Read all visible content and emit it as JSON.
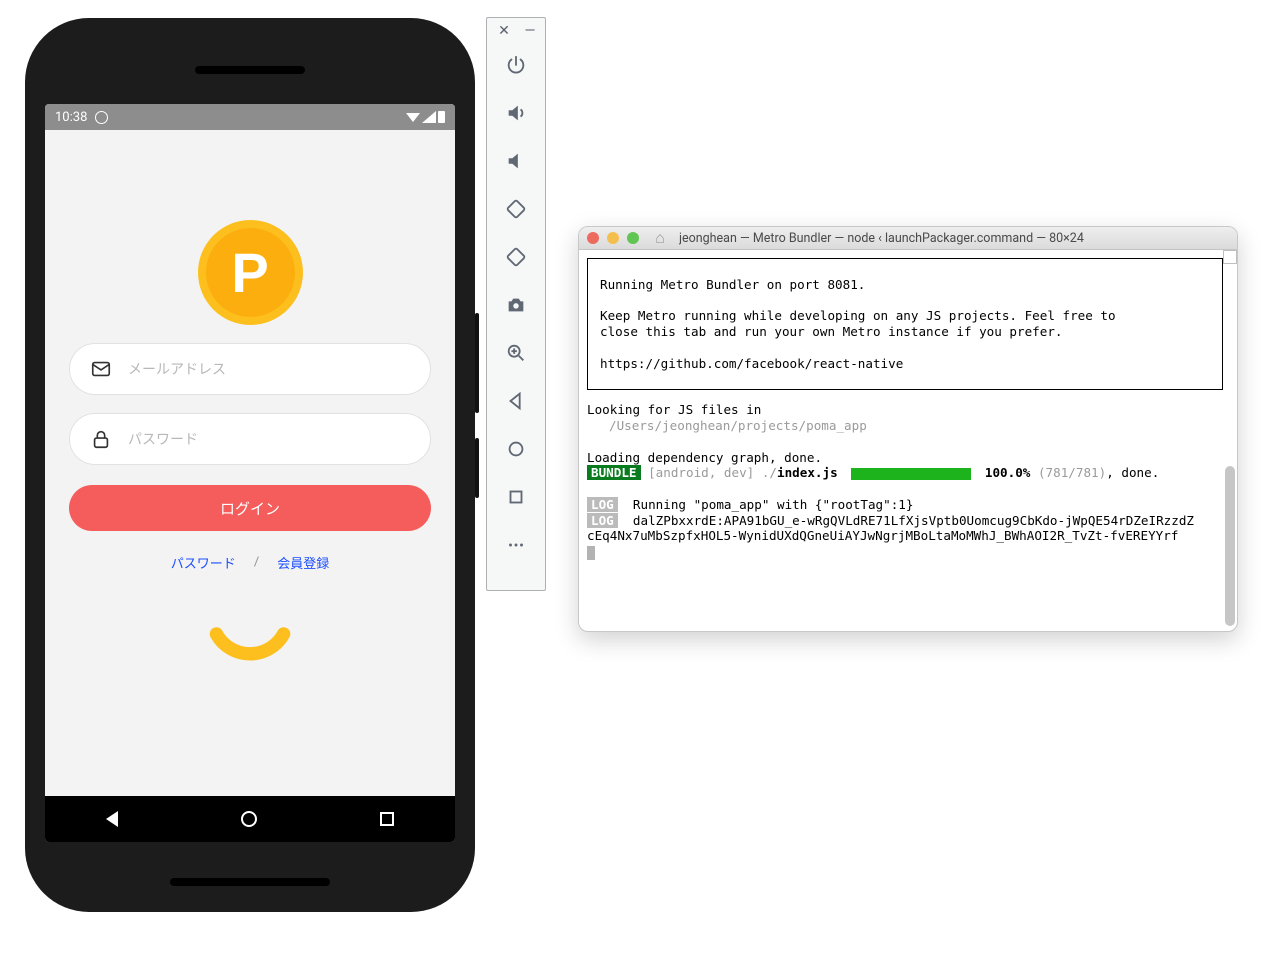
{
  "phone": {
    "status_time": "10:38",
    "coin_letter": "P",
    "email_placeholder": "メールアドレス",
    "password_placeholder": "パスワード",
    "login_label": "ログイン",
    "forgot_label": "パスワード",
    "sep": "/",
    "register_label": "会員登録"
  },
  "terminal": {
    "title": "jeonghean — Metro Bundler — node ‹ launchPackager.command — 80×24",
    "box_line1": "Running Metro Bundler on port 8081.",
    "box_line2a": "Keep Metro running while developing on any JS projects. Feel free to",
    "box_line2b": "close this tab and run your own Metro instance if you prefer.",
    "box_line3": "https://github.com/facebook/react-native",
    "looking": "Looking for JS files in",
    "path": "/Users/jeonghean/projects/poma_app",
    "dep": "Loading dependency graph, done.",
    "bundle_tag": "BUNDLE",
    "bundle_env": "[android, dev]",
    "bundle_dot": " ./",
    "bundle_file": "index.js",
    "bundle_pct": "100.0%",
    "bundle_count": "(781/781)",
    "bundle_done": ", done.",
    "log_tag": "LOG",
    "log1": "Running \"poma_app\" with {\"rootTag\":1}",
    "log2a": "dalZPbxxrdE:APA91bGU_e-wRgQVLdRE71LfXjsVptb0Uomcug9CbKdo-jWpQE54rDZeIRzzdZ",
    "log2b": "cEq4Nx7uMbSzpfxHOL5-WynidUXdQGneUiAYJwNgrjMBoLtaMoMWhJ_BWhAOI2R_TvZt-fvEREYYrf"
  }
}
